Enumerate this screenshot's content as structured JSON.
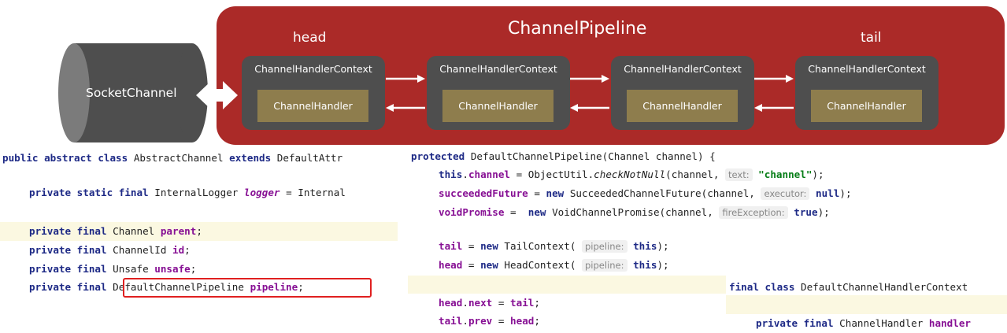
{
  "diagram": {
    "pipeline_title": "ChannelPipeline",
    "head_label": "head",
    "tail_label": "tail",
    "socket_label": "SocketChannel",
    "contexts": [
      {
        "context_label": "ChannelHandlerContext",
        "handler_label": "ChannelHandler"
      },
      {
        "context_label": "ChannelHandlerContext",
        "handler_label": "ChannelHandler"
      },
      {
        "context_label": "ChannelHandlerContext",
        "handler_label": "ChannelHandler"
      },
      {
        "context_label": "ChannelHandlerContext",
        "handler_label": "ChannelHandler"
      }
    ],
    "colors": {
      "pipeline": "#ab2a28",
      "context": "#4e4e4e",
      "handler": "#8e7d4d",
      "socket": "#4e4e4e"
    }
  },
  "code_left": {
    "class_decl": {
      "kw1": "public abstract class",
      "name": " AbstractChannel ",
      "kw2": "extends",
      "rest": " DefaultAttr"
    },
    "logger_line": {
      "kw": "private static final",
      "type": " InternalLogger ",
      "var": "logger",
      "rest": " = Internal"
    },
    "fields": [
      {
        "kw": "private final",
        "type": " Channel ",
        "var": "parent",
        "end": ";"
      },
      {
        "kw": "private final",
        "type": " ChannelId ",
        "var": "id",
        "end": ";"
      },
      {
        "kw": "private final",
        "type": " Unsafe ",
        "var": "unsafe",
        "end": ";"
      },
      {
        "kw": "private final",
        "type": " DefaultChannelPipeline ",
        "var": "pipeline",
        "end": ";"
      }
    ]
  },
  "code_right": {
    "ctor": {
      "kw": "protected",
      "rest": " DefaultChannelPipeline(Channel channel) {"
    },
    "line_channel": {
      "kw": "this",
      "dot": ".",
      "fld": "channel",
      "mid": " = ObjectUtil.",
      "method": "checkNotNull",
      "args": "(channel, ",
      "hint": "text:",
      "str": "\"channel\"",
      "end": ");"
    },
    "line_succeeded": {
      "fld": "succeededFuture",
      "mid": " = ",
      "kw": "new",
      "rest": " SucceededChannelFuture(channel, ",
      "hint": "executor:",
      "val": "null",
      "end": ");"
    },
    "line_void": {
      "fld": "voidPromise",
      "mid": " =  ",
      "kw": "new",
      "rest": " VoidChannelPromise(channel, ",
      "hint": "fireException:",
      "val": "true",
      "end": ");"
    },
    "line_tail": {
      "fld": "tail",
      "mid": " = ",
      "kw": "new",
      "rest": " TailContext( ",
      "hint": "pipeline:",
      "val": "this",
      "end": ");"
    },
    "line_head": {
      "fld": "head",
      "mid": " = ",
      "kw": "new",
      "rest": " HeadContext( ",
      "hint": "pipeline:",
      "val": "this",
      "end": ");"
    },
    "line_next": {
      "f1": "head",
      "dot1": ".",
      "f2": "next",
      "mid": " = ",
      "f3": "tail",
      "end": ";"
    },
    "line_prev": {
      "f1": "tail",
      "dot1": ".",
      "f2": "prev",
      "mid": " = ",
      "f3": "head",
      "end": ";"
    }
  },
  "code_handler_ctx": {
    "class_decl": {
      "kw": "final class",
      "rest": " DefaultChannelHandlerContext"
    },
    "field": {
      "kw": "private final",
      "type": " ChannelHandler ",
      "var": "handler"
    }
  }
}
